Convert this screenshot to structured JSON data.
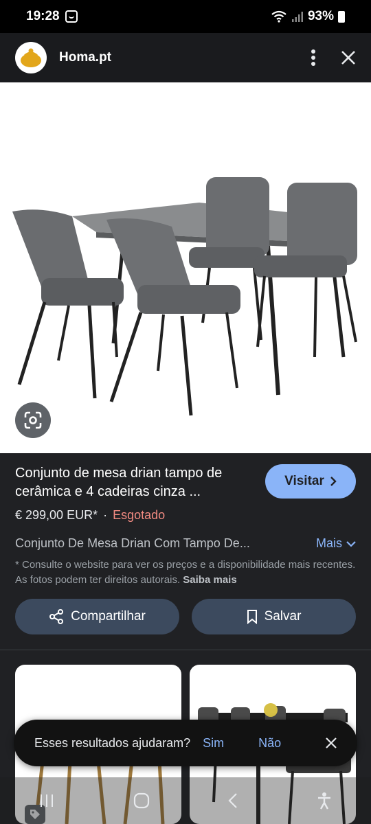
{
  "status_bar": {
    "time": "19:28",
    "battery": "93%"
  },
  "header": {
    "site_name": "Homa.pt",
    "menu_icon": "more-vert-icon",
    "close_icon": "close-icon"
  },
  "product": {
    "title": "Conjunto de mesa drian tampo de cerâmica e 4 cadeiras cinza ...",
    "visit_label": "Visitar",
    "price": "€ 299,00 EUR*",
    "separator": "·",
    "stock_status": "Esgotado",
    "description": "Conjunto De Mesa Drian Com Tampo De...",
    "more_label": "Mais",
    "disclaimer": "* Consulte o website para ver os preços e a disponibilidade mais recentes. As fotos podem ter direitos autorais.",
    "learn_more": "Saiba mais"
  },
  "actions": {
    "share_label": "Compartilhar",
    "save_label": "Salvar"
  },
  "feedback": {
    "question": "Esses resultados ajudaram?",
    "yes": "Sim",
    "no": "Não"
  },
  "colors": {
    "accent": "#8ab4f8",
    "stock": "#f28b82",
    "background": "#202124"
  }
}
